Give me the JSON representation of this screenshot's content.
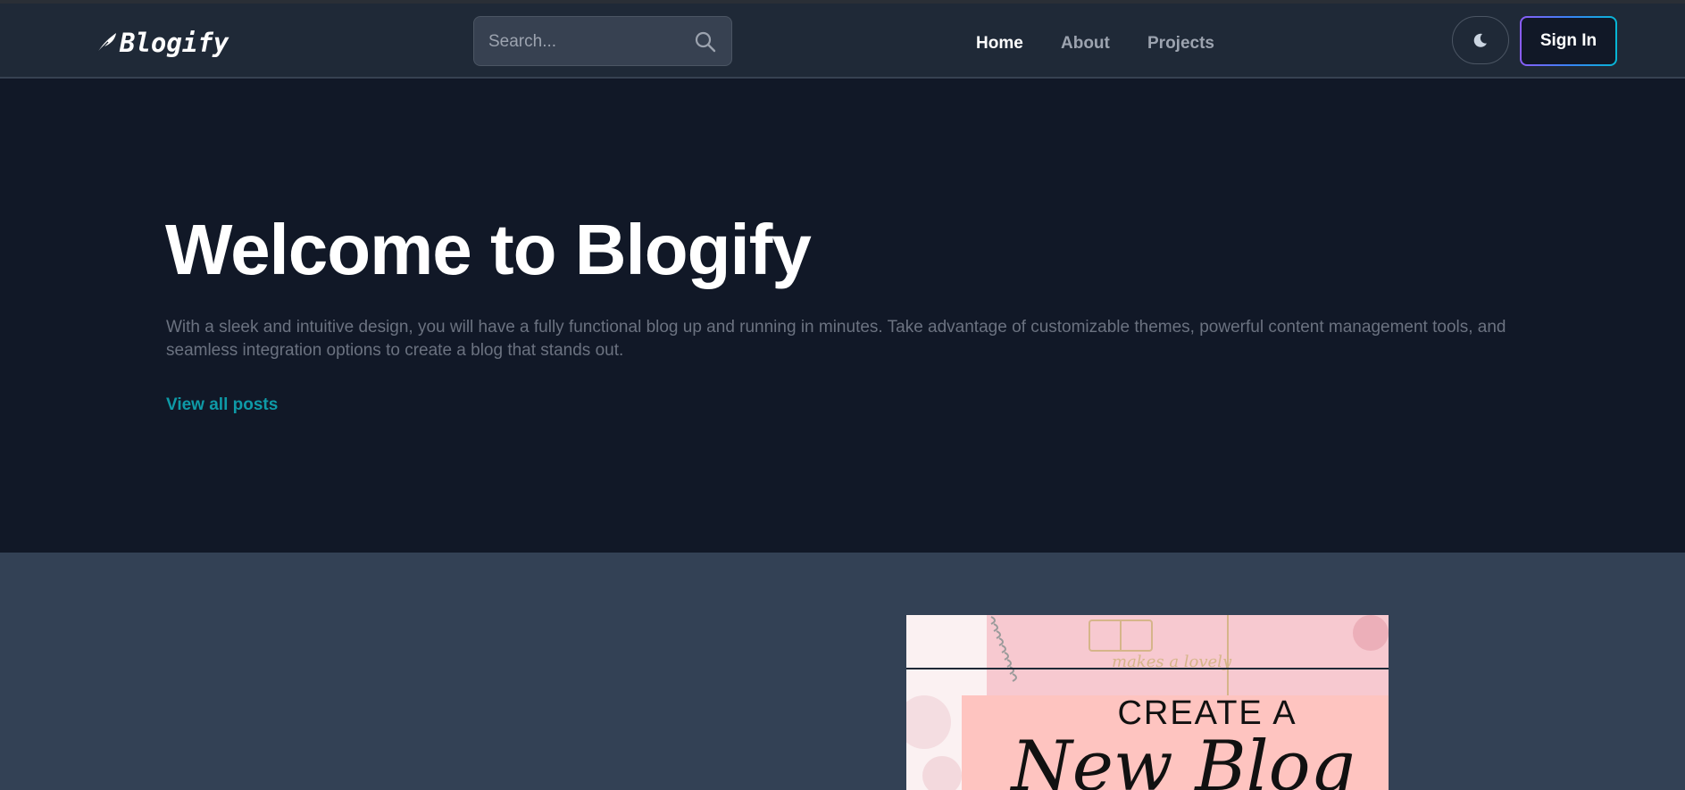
{
  "brand": {
    "name": "Blogify"
  },
  "search": {
    "placeholder": "Search..."
  },
  "nav": {
    "items": [
      {
        "label": "Home",
        "active": true
      },
      {
        "label": "About",
        "active": false
      },
      {
        "label": "Projects",
        "active": false
      }
    ]
  },
  "actions": {
    "theme_icon": "moon-icon",
    "signin_label": "Sign In"
  },
  "hero": {
    "title": "Welcome to Blogify",
    "description": "With a sleek and intuitive design, you will have a fully functional blog up and running in minutes. Take advantage of customizable themes, powerful content management tools, and seamless integration options to create a blog that stands out.",
    "link_label": "View all posts"
  },
  "featured_image": {
    "line1": "CREATE A",
    "line2": "New Blog",
    "notebook_text": "makes a lovely"
  },
  "colors": {
    "navbar_bg": "#1f2937",
    "hero_bg": "#111827",
    "section_bg": "#334155",
    "link_accent": "#0e9aa7",
    "signin_gradient": [
      "#8b5cf6",
      "#3b82f6",
      "#06b6d4"
    ]
  }
}
